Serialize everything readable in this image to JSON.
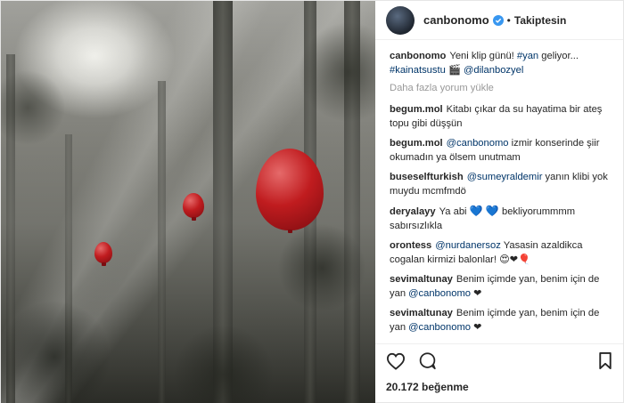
{
  "header": {
    "username": "canbonomo",
    "separator": "•",
    "follow_status": "Takiptesin",
    "verified_icon": "verified-badge-icon",
    "accent": "#3897f0"
  },
  "caption": {
    "user": "canbonomo",
    "text_before": "Yeni klip günü! ",
    "hashtag1": "#yan",
    "text_mid": " geliyor... ",
    "hashtag2": "#kainatsustu",
    "emoji": "🎬",
    "mention": "@dilanbozyel"
  },
  "load_more": "Daha fazla yorum yükle",
  "comments": [
    {
      "user": "begum.mol",
      "text": "Kitabı çıkar da su hayatima bir ateş topu gibi düşşün"
    },
    {
      "user": "begum.mol",
      "mention": "@canbonomo",
      "text": " izmir konserinde şiir okumadın ya ölsem unutmam"
    },
    {
      "user": "buseselfturkish",
      "mention": "@sumeyraldemir",
      "text": " yanın klibi yok muydu mcmfmdö"
    },
    {
      "user": "deryalayy",
      "text_before": "Ya abi ",
      "emoji": "💙 💙",
      "text": " bekliyorummmm sabırsızlıkla"
    },
    {
      "user": "orontess",
      "mention": "@nurdanersoz",
      "text": " Yasasin azaldikca cogalan kirmizi balonlar! ",
      "emoji": "😍❤🎈"
    },
    {
      "user": "sevimaltunay",
      "text_before": "Benim içimde yan, benim için de yan ",
      "mention": "@canbonomo",
      "emoji": "❤"
    },
    {
      "user": "sevimaltunay",
      "text_before": "Benim içimde yan, benim için de yan ",
      "mention": "@canbonomo",
      "emoji": "❤"
    }
  ],
  "actions": {
    "like_icon": "heart-outline-icon",
    "comment_icon": "speech-bubble-icon",
    "save_icon": "bookmark-icon"
  },
  "likes": "20.172 beğenme"
}
